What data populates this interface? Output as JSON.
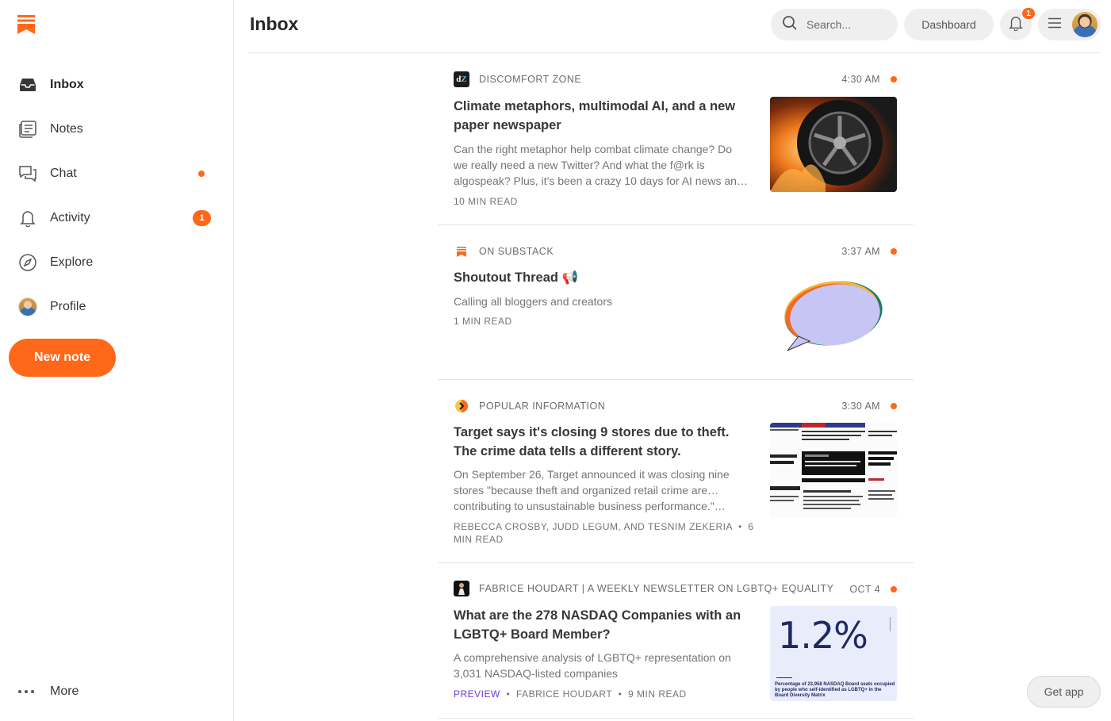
{
  "header": {
    "title": "Inbox",
    "search_placeholder": "Search...",
    "dashboard_label": "Dashboard",
    "notification_count": "1"
  },
  "sidebar": {
    "items": [
      {
        "label": "Inbox",
        "icon": "inbox-icon",
        "active": true
      },
      {
        "label": "Notes",
        "icon": "notes-icon"
      },
      {
        "label": "Chat",
        "icon": "chat-icon",
        "unread_dot": true
      },
      {
        "label": "Activity",
        "icon": "bell-icon",
        "badge": "1"
      },
      {
        "label": "Explore",
        "icon": "compass-icon"
      },
      {
        "label": "Profile",
        "icon": "avatar"
      }
    ],
    "new_note_label": "New note",
    "more_label": "More"
  },
  "posts": [
    {
      "publication": "DISCOMFORT ZONE",
      "time": "4:30 AM",
      "title": "Climate metaphors, multimodal AI, and a new paper newspaper",
      "subtitle": "Can the right metaphor help combat climate change? Do we really need a new Twitter? And what the f@rk is algospeak? Plus, it’s been a crazy 10 days for AI news an…",
      "footer": "10 MIN READ",
      "image": "burning-wheel-image"
    },
    {
      "publication": "ON SUBSTACK",
      "time": "3:37 AM",
      "title": "Shoutout Thread 📢",
      "subtitle": "Calling all bloggers and creators",
      "footer": "1 MIN READ",
      "image": "speech-bubble-image"
    },
    {
      "publication": "POPULAR INFORMATION",
      "time": "3:30 AM",
      "title": "Target says it's closing 9 stores due to theft. The crime data tells a different story.",
      "subtitle": "On September 26, Target announced it was closing nine stores \"because theft and organized retail crime are… contributing to unsustainable business performance.\"…",
      "authors": "REBECCA CROSBY, JUDD LEGUM, AND TESNIM ZEKERIA",
      "read_time": "6 MIN READ",
      "image": "news-collage-image"
    },
    {
      "publication": "FABRICE HOUDART | A WEEKLY NEWSLETTER ON LGBTQ+ EQUALITY",
      "time": "OCT 4",
      "title": "What are the 278 NASDAQ Companies with an LGBTQ+ Board Member?",
      "subtitle": "A comprehensive analysis of LGBTQ+ representation on 3,031 NASDAQ-listed companies",
      "preview_label": "PREVIEW",
      "author": "FABRICE HOUDART",
      "read_time": "9 MIN READ",
      "image_stat": "1.2%",
      "image_caption": "Percentage of 23,958 NASDAQ Board seats occupied by people who self-identified as LGBTQ+ in the Board Diversity Matrix"
    }
  ],
  "get_app_label": "Get app",
  "colors": {
    "accent": "#ff6719",
    "preview": "#6e3bd6"
  }
}
